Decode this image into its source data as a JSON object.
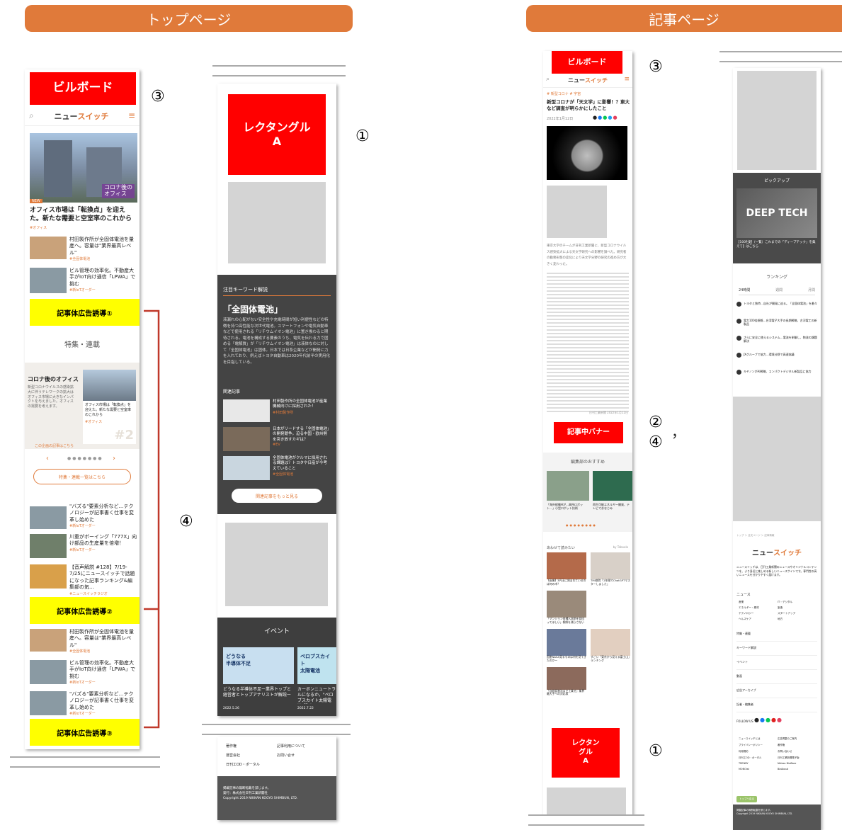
{
  "headers": {
    "top": "トップページ",
    "article": "記事ページ"
  },
  "markers": {
    "n1": "①",
    "n2": "②",
    "comma": "，",
    "n3": "③",
    "n4": "④"
  },
  "ads": {
    "billboard": "ビルボード",
    "rect_a": "レクタングル\nA",
    "rect_a_short": "レクタン\nグル\nA",
    "inline1": "記事体広告誘導①",
    "inline2": "記事体広告誘導②",
    "inline3": "記事体広告誘導③",
    "mid_banner": "記事中バナー"
  },
  "site": {
    "logo_a": "ニュー",
    "logo_b": "スイッチ",
    "sub": "NEWS SWITCH"
  },
  "top": {
    "hero_img": "コロナ後の\nオフィス",
    "hero_badge": "NEW",
    "hero_title": "オフィス市場は「転換点」を迎えた。新たな需要と空室率のこれから",
    "hero_tag": "#オフィス",
    "news": [
      {
        "t": "村田製作所が全固体電池を量産へ。容量は\"業界最高レベル\"",
        "g": "#全固体電池"
      },
      {
        "t": "ビル管理の効率化。不動産大手がIoT向け通信「LPWA」で挑む",
        "g": "#新IoTオーダー"
      }
    ],
    "feature_title": "特集・連載",
    "feature_head": "コロナ後のオフィス",
    "feature_text": "新型コロナウイルスの感染拡大に伴うテレワークの拡大はオフィス市場に大きなインパクトを与えました。オフィスの需要を考えます。",
    "feature_link": "この企画の記事はこちら",
    "feature_card": "オフィス市場は「転換点」を迎えた。新たな需要と空室率のこれから",
    "feature_card_tag": "#オフィス",
    "feature_num": "#2",
    "feature_btn": "特集・連載一覧はこちら",
    "news2": [
      {
        "t": "\"バズる\"要素分析など…テクノロジーが記事書く仕事を変革し始めた",
        "g": "#新IoTオーダー"
      },
      {
        "t": "川重がボーイング「777X」向け部品の生産量を倍増！",
        "g": "#新IoTオーダー"
      },
      {
        "t": "【音声解説 #128】7/19-7/25にニュースイッチで話題になった記事ランキング&編集部の気…",
        "g": "#ニュースイッチラジオ"
      }
    ],
    "news3": [
      {
        "t": "村田製作所が全固体電池を量産へ。容量は\"業界最高レベル\"",
        "g": "#全固体電池"
      },
      {
        "t": "ビル管理の効率化。不動産大手がIoT向け通信「LPWA」で挑む",
        "g": "#新IoTオーダー"
      },
      {
        "t": "\"バズる\"要素分析など…テクノロジーが記事書く仕事を変革し始めた",
        "g": "#新IoTオーダー"
      }
    ]
  },
  "side": {
    "kw_label": "注目キーワード解説",
    "kw_title": "「全固体電池」",
    "kw_text": "液漏れの心配がない安全性や充電時間が短い利便性などの特徴を持つ高性能な次世代電池。スマートフォンや電気自動車などで使用される「リチウムイオン電池」に置き換わると期待される。電池を構成する要素のうち、電気を伝わる力で固める「電解質」が「リチウムイオン電池」は液体なのに対して「全固体電池」は固体。日本では日系企業などが開発に力を入れており、例えばトヨタ自動車は2020年代前半の実用化を目指している。",
    "rel_label": "関連記事",
    "rel": [
      {
        "t": "村田製作所の全固体電池が産業機械向けに採用された！",
        "g": "#村田製作所"
      },
      {
        "t": "日本がリードする「全固体電池」の開発競争。迫る中国・欧州勢を突き放すカギは？",
        "g": "#EV"
      },
      {
        "t": "全固体電池がクルマに採用される課題は？トヨタや日産が今考えていること",
        "g": "#全固体電池"
      }
    ],
    "rel_btn": "関連記事をもっと見る",
    "event_title": "イベント",
    "ev1_head": "どうなる\n半導体不足",
    "ev2_head": "ペロブスカイト\n太陽電池",
    "ev1": "どうなる半導体不足ー業界トップと経営者とトップアナリストが解説ー",
    "ev2": "カーボンニュートラルになるか。\"ペロブスカイト太陽電池\"開発・",
    "ev1_date": "2022.5.26",
    "ev2_date": "2022.7.22",
    "foot_links": [
      "著作権",
      "記事利用について",
      "運営会社",
      "お問い合せ",
      "日刊工OD・ポータル"
    ],
    "foot_text": "掲載記事の無断転載を禁じます。\n発行：株式会社日刊工業新聞社\nCopyright 2019 NIKKAN KOGYO SHIMBUN, LTD."
  },
  "article": {
    "crumb": "# 新型コロナ  # 宇宙",
    "title": "新型コロナが「天文学」に影響！？東大など調査が明らかにしたこと",
    "meta": "2022年1月12日",
    "body": "東京大学のチームが日刊工業新聞に、新型コロナウイルス感染拡大による天文学研究への影響を調べた。研究者の勤務形態の変化により天文学分野の研究の進め方が大きく変わった。",
    "footer_date": "日刊工業新聞 2022年1月12日",
    "rec_title": "編集部のおすすめ",
    "rec": [
      "「海外経験Hが…高所ロボット…」小型ロボット技術",
      "再生可能エネルギー開発、テレビでおなじみ"
    ],
    "read_title": "あわせて読みたい",
    "read_by": "by Taboola",
    "read": [
      {
        "t": "【画像】3円玉に刻まれているのは何の木？",
        "g": "Kurashi"
      },
      {
        "t": "TMI病院「2年間でChatGPTマスターしました」",
        "g": "GIGAZINE"
      },
      {
        "t": "「マンション各種入居前を見回ってほしい」傾斜を減らさない",
        "g": "TOKYO"
      },
      {
        "t": "国産NASA見るものは何を見てきたのかー",
        "g": "Sponsored"
      },
      {
        "t": "すごい「東京から見える富士山」ランキング",
        "g": "Sponsored"
      },
      {
        "t": "「自殺促進法まで上乗せ」業界最大手への対応策",
        "g": "ニュース"
      }
    ],
    "pickup": "ピックアップ",
    "deep": "DEEP TECH",
    "deep_cap": "【100社超（一覧）これまでの「ディープテック」を集えて】はこちら",
    "rank_title": "ランキング",
    "rank_tabs": [
      "24時間",
      "週間",
      "月間"
    ],
    "rank": [
      "トヨタと独特…自社が開発に迫る。「全固体電池」を着々",
      "電力100倍規格…台湾電子大手の長期戦略、古河電工の新製品",
      "さらに安全に使えるシステム…電流を制御し、物流の課題解決",
      "JXグループで協力…環境分野で高速協議",
      "キヤノンがAI戦略、コンパクトデジタル新製品に協力"
    ],
    "foot_crumb": "トップ ＞ 全文ページ ＞ 記事情報",
    "site_text": "ニュースイッチは、日刊工業新聞のニュースやオリジナルコンテンツを、より身近に楽しめる新しいニュースサイトです。専門性の高いニュースを分かりやすく届けます。",
    "cats_title": "ニュース",
    "cats": [
      "産業",
      "エネルギー・素材",
      "テクノロジー",
      "ヘルスケア",
      "IT・デジタル",
      "製造",
      "スタートアップ",
      "地方"
    ],
    "menu": [
      "特集・連載",
      "キーワード解説",
      "イベント",
      "動画",
      "広告アーカイブ",
      "記者・編集者"
    ],
    "follow": "FOLLOW US",
    "links": [
      "ニュースイッチとは",
      "広告掲載のご案内",
      "プライバシーポリシー",
      "著作権",
      "利用規約",
      "お問い合わせ",
      "日刊工OD・ポータル",
      "日刊工業新聞電子版",
      "TRENDY",
      "Nikkan BizWare",
      "MONOist",
      "BizAbout"
    ],
    "more_btn": "トップへ戻る",
    "copyright": "掲載記事の無断転載を禁じます。\nCopyright 2019 NIKKAN KOGYO SHIMBUN, LTD."
  }
}
